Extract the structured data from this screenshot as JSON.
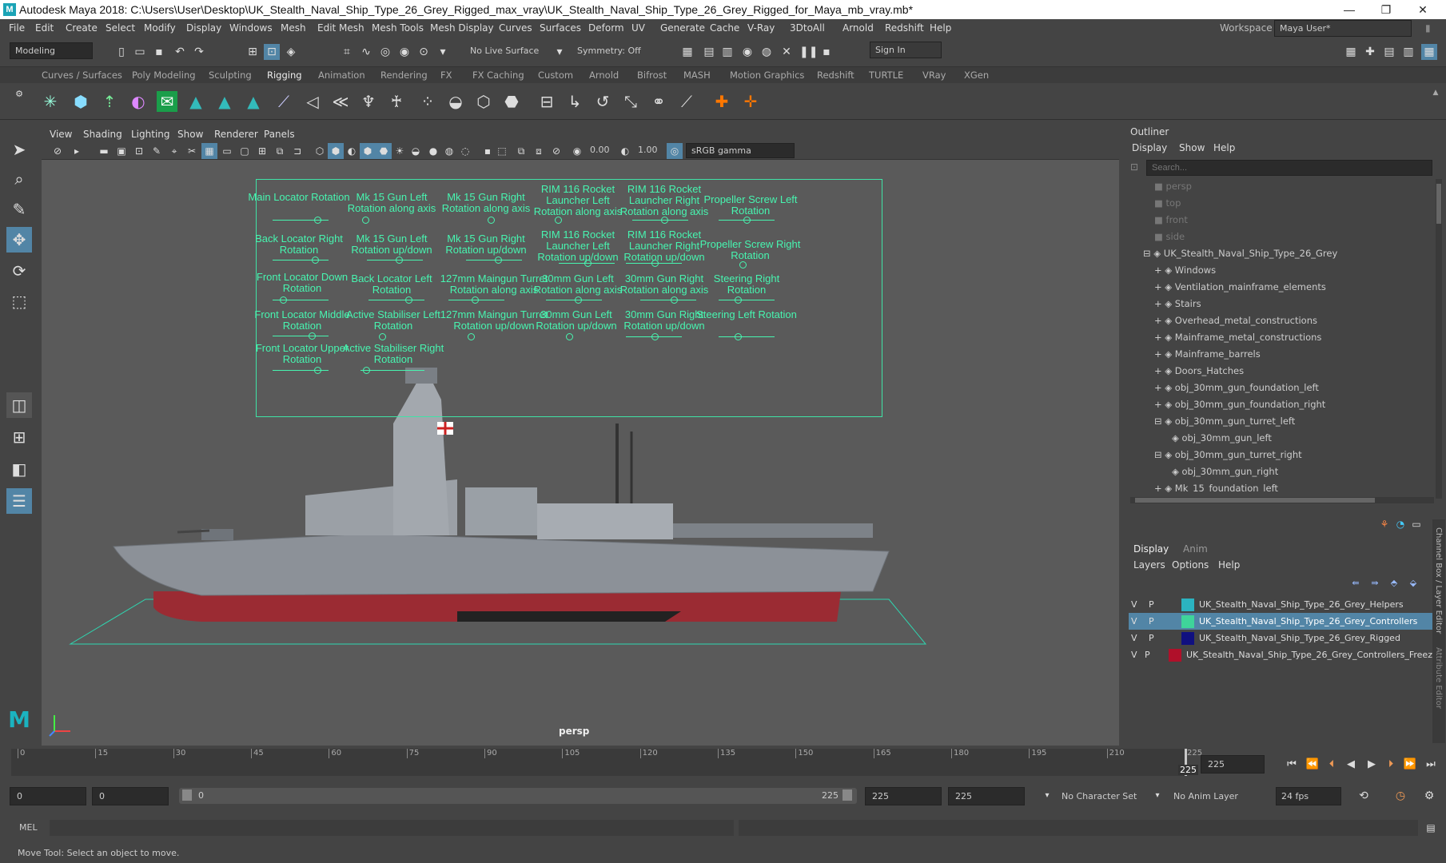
{
  "window": {
    "title": "Autodesk Maya 2018: C:\\Users\\User\\Desktop\\UK_Stealth_Naval_Ship_Type_26_Grey_Rigged_max_vray\\UK_Stealth_Naval_Ship_Type_26_Grey_Rigged_for_Maya_mb_vray.mb*",
    "min": "—",
    "max": "❐",
    "close": "✕"
  },
  "menu": [
    "File",
    "Edit",
    "Create",
    "Select",
    "Modify",
    "Display",
    "Windows",
    "Mesh",
    "Edit Mesh",
    "Mesh Tools",
    "Mesh Display",
    "Curves",
    "Surfaces",
    "Deform",
    "UV",
    "Generate",
    "Cache",
    "V-Ray",
    "3DtoAll",
    "Arnold",
    "Redshift",
    "Help"
  ],
  "workspace": {
    "label": "Workspace :",
    "value": "Maya User*"
  },
  "status": {
    "mode": "Modeling",
    "live_surface": "No Live Surface",
    "symmetry": "Symmetry: Off",
    "sign_in": "Sign In"
  },
  "shelf_tabs": [
    "Curves / Surfaces",
    "Poly Modeling",
    "Sculpting",
    "Rigging",
    "Animation",
    "Rendering",
    "FX",
    "FX Caching",
    "Custom",
    "Arnold",
    "Bifrost",
    "MASH",
    "Motion Graphics",
    "Redshift",
    "TURTLE",
    "VRay",
    "XGen"
  ],
  "shelf_active": "Rigging",
  "viewport_menu": [
    "View",
    "Shading",
    "Lighting",
    "Show",
    "Renderer",
    "Panels"
  ],
  "viewport_fields": {
    "exposure": "0.00",
    "gamma": "1.00",
    "color_space": "sRGB gamma"
  },
  "viewport_label": "persp",
  "controls": {
    "c1": "Main Locator Rotation",
    "c2": "Mk 15 Gun Left Rotation along axis",
    "c3": "Mk 15 Gun Right Rotation along axis",
    "c4": "RIM 116 Rocket Launcher Left Rotation along axis",
    "c5": "RIM 116 Rocket Launcher Right Rotation along axis",
    "c6": "Propeller Screw Left Rotation",
    "c7": "Back Locator Right Rotation",
    "c8": "Mk 15 Gun Left Rotation up/down",
    "c9": "Mk 15 Gun Right Rotation up/down",
    "c10": "RIM 116 Rocket Launcher Left Rotation up/down",
    "c11": "RIM 116 Rocket Launcher Right Rotation up/down",
    "c12": "Propeller Screw Right Rotation",
    "c13": "Front Locator Down Rotation",
    "c14": "Back Locator Left Rotation",
    "c15": "127mm Maingun Turret Rotation along axis",
    "c16": "30mm Gun Left Rotation along axis",
    "c17": "30mm Gun Right Rotation along axis",
    "c18": "Steering Right Rotation",
    "c19": "Front Locator Middle Rotation",
    "c20": "Active Stabiliser Left Rotation",
    "c21": "127mm Maingun Turret Rotation up/down",
    "c22": "30mm Gun Left Rotation up/down",
    "c23": "30mm Gun Right Rotation up/down",
    "c24": "Steering Left Rotation",
    "c25": "Front Locator Upper Rotation",
    "c26": "Active Stabiliser Right Rotation"
  },
  "outliner": {
    "title": "Outliner",
    "menu": [
      "Display",
      "Show",
      "Help"
    ],
    "search_placeholder": "Search...",
    "items": [
      "persp",
      "top",
      "front",
      "side",
      "UK_Stealth_Naval_Ship_Type_26_Grey",
      "Windows",
      "Ventilation_mainframe_elements",
      "Stairs",
      "Overhead_metal_constructions",
      "Mainframe_metal_constructions",
      "Mainframe_barrels",
      "Doors_Hatches",
      "obj_30mm_gun_foundation_left",
      "obj_30mm_gun_foundation_right",
      "obj_30mm_gun_turret_left",
      "obj_30mm_gun_left",
      "obj_30mm_gun_turret_right",
      "obj_30mm_gun_right",
      "Mk_15_foundation_left"
    ]
  },
  "layer_editor": {
    "tabs": [
      "Display",
      "Anim"
    ],
    "menu": [
      "Layers",
      "Options",
      "Help"
    ],
    "layers": [
      {
        "v": "V",
        "p": "P",
        "name": "UK_Stealth_Naval_Ship_Type_26_Grey_Helpers",
        "color": "#2bb3c0"
      },
      {
        "v": "V",
        "p": "P",
        "name": "UK_Stealth_Naval_Ship_Type_26_Grey_Controllers",
        "color": "#3fd49a"
      },
      {
        "v": "V",
        "p": "P",
        "name": "UK_Stealth_Naval_Ship_Type_26_Grey_Rigged",
        "color": "#101080"
      },
      {
        "v": "V",
        "p": "P",
        "name": "UK_Stealth_Naval_Ship_Type_26_Grey_Controllers_Freeze",
        "color": "#b0102a"
      }
    ]
  },
  "side_tabs": {
    "channel": "Channel Box / Layer Editor",
    "attr": "Attribute Editor"
  },
  "timeline": {
    "ticks": [
      "0",
      "15",
      "30",
      "45",
      "60",
      "75",
      "90",
      "105",
      "120",
      "135",
      "150",
      "165",
      "180",
      "195",
      "210",
      "225"
    ],
    "current": "225",
    "current_field": "225"
  },
  "range": {
    "start": "0",
    "start2": "0",
    "slider_start": "0",
    "slider_end": "225",
    "end": "225",
    "end2": "225",
    "char_set": "No Character Set",
    "anim_layer": "No Anim Layer",
    "fps": "24 fps"
  },
  "cmd": {
    "label": "MEL"
  },
  "help_line": "Move Tool: Select an object to move."
}
